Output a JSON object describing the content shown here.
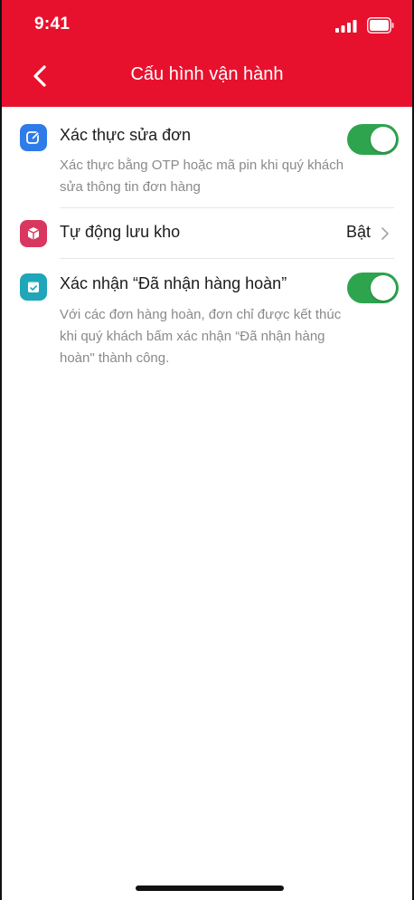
{
  "status_bar": {
    "time": "9:41",
    "signal_icon": "cellular-signal-icon",
    "battery_icon": "battery-icon"
  },
  "header": {
    "title": "Cấu hình vận hành",
    "back_icon": "chevron-left-icon",
    "background_color": "#e8112d"
  },
  "settings": [
    {
      "icon": "edit-icon",
      "icon_color": "#2f7be8",
      "title": "Xác thực sửa đơn",
      "description": "Xác thực bằng OTP hoặc mã pin khi quý khách sửa thông tin đơn hàng",
      "control": "toggle",
      "enabled": true
    },
    {
      "icon": "box-icon",
      "icon_color": "#d9375f",
      "title": "Tự động lưu kho",
      "control": "value",
      "value": "Bật"
    },
    {
      "icon": "calendar-check-icon",
      "icon_color": "#1fa6b8",
      "title": "Xác nhận “Đã nhận hàng hoàn”",
      "description": "Với các đơn hàng hoàn, đơn chỉ được kết thúc khi quý khách bấm xác nhận “Đã nhận hàng hoàn\" thành công.",
      "control": "toggle",
      "enabled": true
    }
  ],
  "colors": {
    "accent_red": "#e8112d",
    "toggle_on": "#2ea44f"
  }
}
